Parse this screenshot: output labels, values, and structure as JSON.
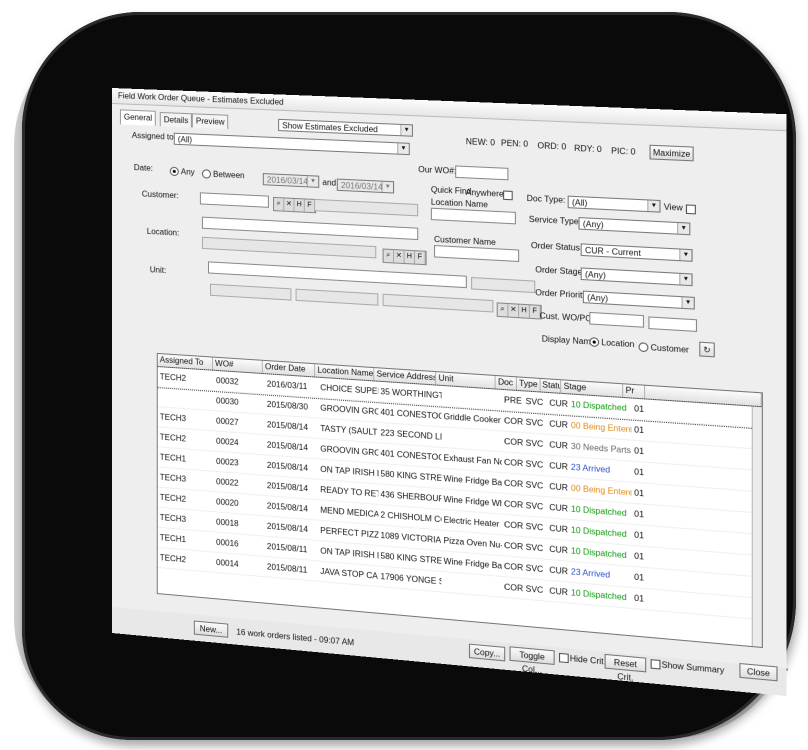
{
  "window": {
    "title": "Field Work Order Queue - Estimates Excluded"
  },
  "tabs": [
    {
      "label": "General"
    },
    {
      "label": "Details"
    },
    {
      "label": "Preview"
    }
  ],
  "filter_select": "Show Estimates Excluded",
  "counts": {
    "new": "NEW: 0",
    "pen": "PEN: 0",
    "ord": "ORD: 0",
    "rdy": "RDY: 0",
    "pic": "PIC: 0"
  },
  "maximize_label": "Maximize",
  "form": {
    "assigned_to_label": "Assigned to:",
    "assigned_to_value": "(All)",
    "our_wo_label": "Our WO#:",
    "date_label": "Date:",
    "radio_any": "Any",
    "radio_between": "Between",
    "date_from": "2016/03/14",
    "date_and": "and",
    "date_to": "2016/03/14",
    "quick_find_label": "Quick Find",
    "anywhere_label": "Anywhere",
    "location_name_label": "Location Name",
    "customer_name_label": "Customer Name",
    "customer_label": "Customer:",
    "location_label": "Location:",
    "unit_label": "Unit:",
    "doc_type_label": "Doc Type:",
    "doc_type_value": "(All)",
    "view2_label": "View 2",
    "service_type_label": "Service Type:",
    "service_type_value": "(Any)",
    "order_status_label": "Order Status:",
    "order_status_value": "CUR - Current",
    "order_stage_label": "Order Stage:",
    "order_stage_value": "(Any)",
    "order_priority_label": "Order Priority:",
    "order_priority_value": "(Any)",
    "cust_wo_label": "Cust. WO/PO:",
    "display_name_label": "Display Name:",
    "display_location": "Location",
    "display_customer": "Customer"
  },
  "grid": {
    "columns": [
      "Assigned To",
      "WO#",
      "Order Date",
      "Location Name",
      "Service Address",
      "Unit",
      "Doc",
      "Type",
      "Status",
      "Stage",
      "Pr",
      ""
    ],
    "rows": [
      {
        "assigned": "TECH2",
        "wo": "00032",
        "date": "2016/03/11",
        "location": "CHOICE SUPERMARKETS",
        "address": "35 WORTHINGTO...",
        "unit": "",
        "doc": "PRE",
        "type": "SVC",
        "status": "CUR",
        "stage": "10 Dispatched",
        "stage_class": "stage-dispatched",
        "pr": "01"
      },
      {
        "assigned": "",
        "wo": "00030",
        "date": "2015/08/30",
        "location": "GROOVIN GROCERS",
        "address": "401 CONESTOGA ...",
        "unit": "Griddle Cooker CG-...",
        "doc": "COR",
        "type": "SVC",
        "status": "CUR",
        "stage": "00 Being Entered",
        "stage_class": "stage-entered",
        "pr": "01"
      },
      {
        "assigned": "TECH3",
        "wo": "00027",
        "date": "2015/08/14",
        "location": "TASTY (SAULT STE MA...",
        "address": "223 SECOND LINE ...",
        "unit": "",
        "doc": "COR",
        "type": "SVC",
        "status": "CUR",
        "stage": "30 Needs Parts",
        "stage_class": "stage-parts",
        "pr": "01"
      },
      {
        "assigned": "TECH2",
        "wo": "00024",
        "date": "2015/08/14",
        "location": "GROOVIN GROCERS",
        "address": "401 CONESTOGA ...",
        "unit": "Exhaust Fan Nov...",
        "doc": "COR",
        "type": "SVC",
        "status": "CUR",
        "stage": "23 Arrived",
        "stage_class": "stage-arrived",
        "pr": "01"
      },
      {
        "assigned": "TECH1",
        "wo": "00023",
        "date": "2015/08/14",
        "location": "ON TAP IRISH PUB",
        "address": "580 KING STREET ...",
        "unit": "Wine Fridge Bar M...",
        "doc": "COR",
        "type": "SVC",
        "status": "CUR",
        "stage": "00 Being Entered",
        "stage_class": "stage-entered",
        "pr": "01"
      },
      {
        "assigned": "TECH3",
        "wo": "00022",
        "date": "2015/08/14",
        "location": "READY TO RETIRE RES...",
        "address": "436 SHERBOURNE...",
        "unit": "Wine Fridge Whi...",
        "doc": "COR",
        "type": "SVC",
        "status": "CUR",
        "stage": "10 Dispatched",
        "stage_class": "stage-dispatched",
        "pr": "01"
      },
      {
        "assigned": "TECH2",
        "wo": "00020",
        "date": "2015/08/14",
        "location": "MEND MEDICAL CLINIC",
        "address": "2 CHISHOLM COU...",
        "unit": "Electric Heater Ou...",
        "doc": "COR",
        "type": "SVC",
        "status": "CUR",
        "stage": "10 Dispatched",
        "stage_class": "stage-dispatched",
        "pr": "01"
      },
      {
        "assigned": "TECH3",
        "wo": "00018",
        "date": "2015/08/14",
        "location": "PERFECT PIZZERIA",
        "address": "1089 VICTORIA P...",
        "unit": "Pizza Oven Nu-Pu...",
        "doc": "COR",
        "type": "SVC",
        "status": "CUR",
        "stage": "10 Dispatched",
        "stage_class": "stage-dispatched",
        "pr": "01"
      },
      {
        "assigned": "TECH1",
        "wo": "00016",
        "date": "2015/08/11",
        "location": "ON TAP IRISH PUB",
        "address": "580 KING STREET ...",
        "unit": "Wine Fridge Bar M...",
        "doc": "COR",
        "type": "SVC",
        "status": "CUR",
        "stage": "23 Arrived",
        "stage_class": "stage-arrived",
        "pr": "01"
      },
      {
        "assigned": "TECH2",
        "wo": "00014",
        "date": "2015/08/11",
        "location": "JAVA STOP CAFE",
        "address": "17906 YONGE STR...",
        "unit": "",
        "doc": "COR",
        "type": "SVC",
        "status": "CUR",
        "stage": "10 Dispatched",
        "stage_class": "stage-dispatched",
        "pr": "01"
      }
    ]
  },
  "footer": {
    "new_button": "New...",
    "status_text": "16 work orders listed - 09:07 AM",
    "copy_button": "Copy...",
    "toggle_button": "Toggle Col...",
    "hide_label": "Hide Crit.",
    "reset_button": "Reset Crit.",
    "summary_label": "Show Summary",
    "close_button": "Close"
  }
}
